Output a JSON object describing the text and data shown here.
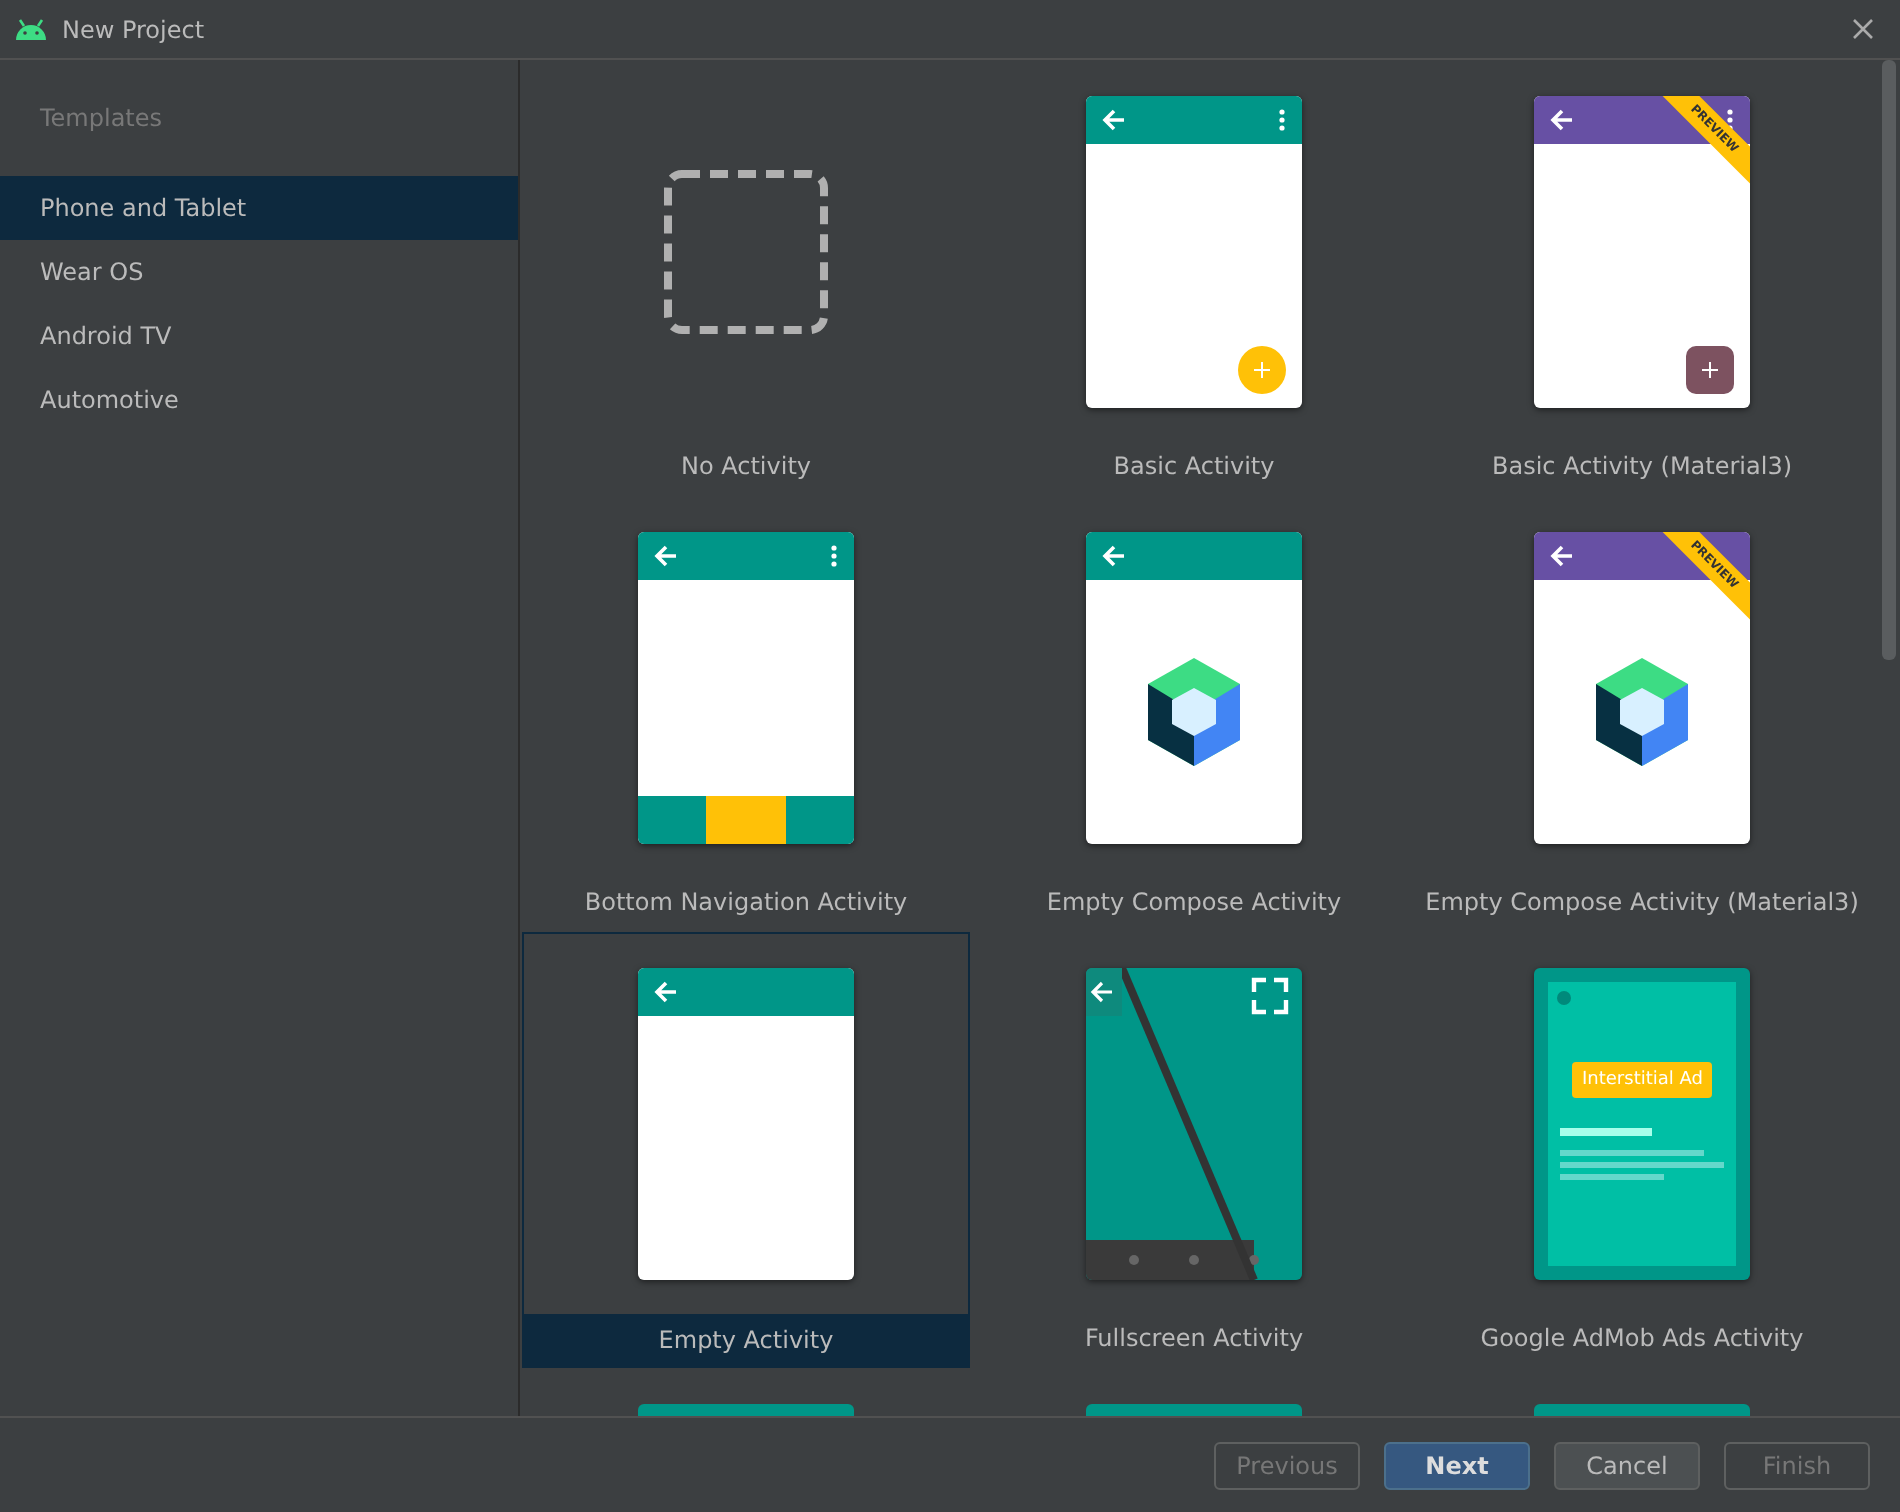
{
  "window": {
    "title": "New Project"
  },
  "sidebar": {
    "heading": "Templates",
    "items": [
      {
        "label": "Phone and Tablet",
        "selected": true
      },
      {
        "label": "Wear OS",
        "selected": false
      },
      {
        "label": "Android TV",
        "selected": false
      },
      {
        "label": "Automotive",
        "selected": false
      }
    ]
  },
  "templates": [
    {
      "kind": "none",
      "label": "No Activity",
      "selected": false
    },
    {
      "kind": "basic",
      "color": "#009688",
      "label": "Basic Activity",
      "selected": false
    },
    {
      "kind": "basic-m3",
      "color": "#6750a4",
      "ribbon": "PREVIEW",
      "label": "Basic Activity (Material3)",
      "selected": false
    },
    {
      "kind": "bottom-nav",
      "color": "#009688",
      "label": "Bottom Navigation Activity",
      "selected": false
    },
    {
      "kind": "compose",
      "color": "#009688",
      "label": "Empty Compose Activity",
      "selected": false
    },
    {
      "kind": "compose",
      "color": "#6750a4",
      "ribbon": "PREVIEW",
      "label": "Empty Compose Activity (Material3)",
      "selected": false
    },
    {
      "kind": "empty",
      "color": "#009688",
      "label": "Empty Activity",
      "selected": true
    },
    {
      "kind": "fullscreen",
      "label": "Fullscreen Activity",
      "selected": false
    },
    {
      "kind": "admob",
      "ad_text": "Interstitial Ad",
      "label": "Google AdMob Ads Activity",
      "selected": false
    },
    {
      "kind": "cut-off",
      "color": "#009688"
    },
    {
      "kind": "cut-off",
      "color": "#009688"
    },
    {
      "kind": "cut-off",
      "color": "#009688"
    }
  ],
  "buttons": [
    {
      "label": "Previous",
      "kind": "secondary",
      "disabled": true
    },
    {
      "label": "Next",
      "kind": "primary",
      "disabled": false
    },
    {
      "label": "Cancel",
      "kind": "secondary",
      "disabled": false
    },
    {
      "label": "Finish",
      "kind": "secondary",
      "disabled": true
    }
  ]
}
